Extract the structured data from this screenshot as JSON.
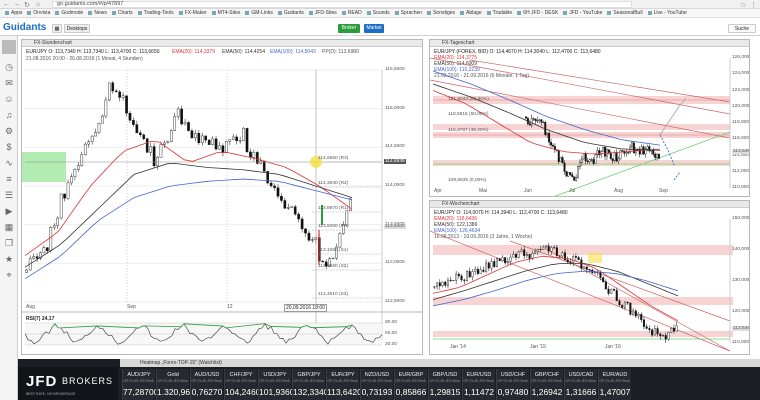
{
  "browser": {
    "url": "go.guidants.com/#/p/47897",
    "bookmarks": [
      "Apps",
      "Onvista",
      "Godmode",
      "News",
      "Charts",
      "Trading-Tools",
      "FX-Maker",
      "MT4-Sites",
      "GM-Links",
      "Guidants",
      "JFD-Sites",
      "READ",
      "Sounds",
      "Sprachen",
      "Sonstiges",
      "Ablage",
      "Tradable",
      "6H JFD - DESK",
      "JFD - YouTube",
      "SeasonalBull",
      "Live - YouTube"
    ]
  },
  "app": {
    "logo": "Guidants",
    "desktop_label": "Desktops",
    "broker_login": "Broker Login",
    "market_label": "Market",
    "search_label": "Suche"
  },
  "colors": {
    "buy": "#2a9d3a",
    "sell": "#d23b3b",
    "ema20": "#d33",
    "ema50": "#333",
    "ema100": "#4466cc",
    "fib": "#f3c0c0",
    "ticker_bg": "#1b1e24"
  },
  "hourly": {
    "title": "FX-Stundenchart",
    "legend_line1": "EUR/JPY  O: 113,7340  H: 113,7340  L: 113,4700  C: 113,6650",
    "ema20": "EMA(20): 114,3379",
    "ema50": "EMA(50): 114,4254",
    "ema100": "EMA(100): 114,5043",
    "pp": "PP(D): 113,6980",
    "date_line": "21.08.2016 20:00 - 26.08.2016 (1 Monat, 4 Stunden)",
    "price_levels": [
      {
        "label": "114,6650 (R3)",
        "price": 114.665
      },
      {
        "label": "114,3040 (R2)",
        "price": 114.304
      },
      {
        "label": "113,8970 (R1)",
        "price": 113.897
      },
      {
        "label": "113,5050 (PP)",
        "price": 113.505
      },
      {
        "label": "113,1080 (S1)",
        "price": 113.108
      },
      {
        "label": "112,9080 (S2)",
        "price": 112.908
      },
      {
        "label": "112,4610 (S3)",
        "price": 112.461
      }
    ],
    "y_ticks": [
      "115,5000",
      "115,0000",
      "114,5000",
      "114,0000",
      "113,5000",
      "113,0000",
      "112,5000"
    ],
    "last_price": "114,6939",
    "current_price": "113,6400",
    "x_ticks": [
      "Aug",
      "Sep",
      "12"
    ],
    "cursor_time": "20.09.2016 18:00",
    "rsi_label": "RSI(7)  24,17",
    "rsi_ticks": [
      "80,00",
      "50,00",
      "20,00"
    ]
  },
  "daily": {
    "title": "FX-Tageschart",
    "legend_line1": "EUR/JPY (FOREX, BID)  O: 114,4670  H: 114,3040  L: 112,4700  C: 113,6480",
    "ema20": "EMA(20): 114,3775",
    "ema50": "EMA(50): 114,6009",
    "ema100": "EMA(100): 115,2239",
    "date_line": "21.03.2016 - 21.09.2016 (6 Monate, 1 Tag)",
    "fib_levels": [
      "121,8043 (61,80%)",
      "118,5815 (50,00%)",
      "116,3787 (38,20%)",
      "109,5635 (0,00%)"
    ],
    "y_ticks": [
      "126,0000",
      "124,0000",
      "122,0000",
      "120,0000",
      "118,0000",
      "116,0000",
      "114,0000",
      "112,0000",
      "110,0000"
    ],
    "current_price": "113,6480",
    "x_ticks": [
      "Apr",
      "Mai",
      "Jun",
      "Jul",
      "Aug",
      "Sep"
    ]
  },
  "weekly": {
    "title": "FX-Wochenchart",
    "legend_line1": "EUR/JPY  O: 114,0070  H: 114,3940  L: 112,4700  C: 113,6480",
    "ema20": "EMA(20): 118,6436",
    "ema50": "EMA(50): 122,1386",
    "ema100": "EMA(100): 126,4634",
    "date_line": "16.09.2013 - 19.09.2016 (3 Jahre, 1 Woche)",
    "y_ticks": [
      "150,0000",
      "140,0000",
      "130,0000",
      "120,0000",
      "110,0000"
    ],
    "current_price": "113,6480",
    "x_ticks": [
      "Jan '14",
      "Jan '15",
      "Jan '16"
    ]
  },
  "ticker": {
    "title": "Heatmap „Forex-TOP-15\" (Watchlist)",
    "brand": "JFD",
    "brand_sub": "BROKERS",
    "brand_tag": "BEST RATE. NO BROKERAGE",
    "items": [
      {
        "name": "AUD/JPY",
        "value": "77,28700"
      },
      {
        "name": "Gold",
        "value": "1.320,96"
      },
      {
        "name": "AUD/USD",
        "value": "0,76270"
      },
      {
        "name": "CHF/JPY",
        "value": "104,24600"
      },
      {
        "name": "USD/JPY",
        "value": "101,93600"
      },
      {
        "name": "GBP/JPY",
        "value": "132,33400"
      },
      {
        "name": "EUR/JPY",
        "value": "113,64200"
      },
      {
        "name": "NZD/USD",
        "value": "0,73193"
      },
      {
        "name": "EUR/GBP",
        "value": "0,85866"
      },
      {
        "name": "GBP/USD",
        "value": "1,29815"
      },
      {
        "name": "EUR/USD",
        "value": "1,11472"
      },
      {
        "name": "USD/CHF",
        "value": "0,97480"
      },
      {
        "name": "GBP/CHF",
        "value": "1,26942"
      },
      {
        "name": "USD/CAD",
        "value": "1,31666"
      },
      {
        "name": "EUR/AUD",
        "value": "1,47007"
      }
    ],
    "sub_label": "GP 01:45  JFD Brok."
  }
}
